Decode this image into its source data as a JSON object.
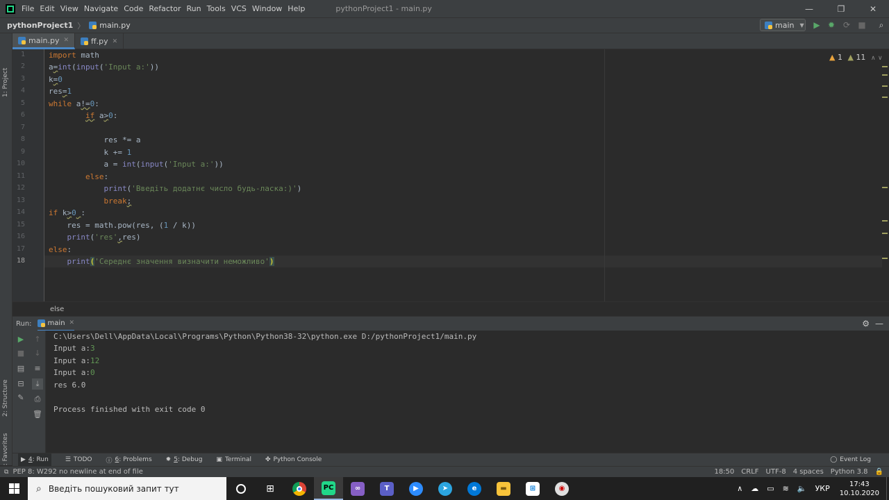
{
  "menubar": {
    "items": [
      "File",
      "Edit",
      "View",
      "Navigate",
      "Code",
      "Refactor",
      "Run",
      "Tools",
      "VCS",
      "Window",
      "Help"
    ],
    "window_title": "pythonProject1 - main.py",
    "minimize": "—",
    "maximize": "❐",
    "close": "✕"
  },
  "navbar": {
    "project": "pythonProject1",
    "file": "main.py",
    "run_config": "main",
    "run_config_arrow": "▼"
  },
  "left_strip": {
    "project_label": "1: Project",
    "structure_label": "2: Structure",
    "favorites_label": "2: Favorites"
  },
  "editor_tabs": [
    {
      "label": "main.py",
      "close": "✕",
      "active": true
    },
    {
      "label": "ff.py",
      "close": "✕",
      "active": false
    }
  ],
  "inspections": {
    "warnings": "1",
    "weak_warnings": "11"
  },
  "editor": {
    "line_numbers": [
      "1",
      "2",
      "3",
      "4",
      "5",
      "6",
      "7",
      "8",
      "9",
      "10",
      "11",
      "12",
      "13",
      "14",
      "15",
      "16",
      "17",
      "18"
    ],
    "current_line": 18
  },
  "breadcrumb_bottom": "else",
  "run_panel": {
    "label": "Run:",
    "tab": "main",
    "console_lines": [
      {
        "text": "C:\\Users\\Dell\\AppData\\Local\\Programs\\Python\\Python38-32\\python.exe D:/pythonProject1/main.py"
      },
      {
        "prompt": "Input a:",
        "input": "3"
      },
      {
        "prompt": "Input a:",
        "input": "12"
      },
      {
        "prompt": "Input a:",
        "input": "0"
      },
      {
        "text": "res 6.0"
      },
      {
        "text": ""
      },
      {
        "text": "Process finished with exit code 0"
      }
    ]
  },
  "tool_tabs": [
    {
      "num": "4",
      "label": ": Run",
      "icon": "run-icon"
    },
    {
      "num": "",
      "label": "TODO",
      "icon": "todo-icon"
    },
    {
      "num": "6",
      "label": ": Problems",
      "icon": "problems-icon"
    },
    {
      "num": "5",
      "label": ": Debug",
      "icon": "debug-icon"
    },
    {
      "num": "",
      "label": "Terminal",
      "icon": "terminal-icon"
    },
    {
      "num": "",
      "label": "Python Console",
      "icon": "python-console-icon"
    }
  ],
  "event_log": "Event Log",
  "statusbar": {
    "message": "PEP 8: W292 no newline at end of file",
    "position": "18:50",
    "line_sep": "CRLF",
    "encoding": "UTF-8",
    "indent": "4 spaces",
    "interpreter": "Python 3.8"
  },
  "taskbar": {
    "search_placeholder": "Введіть пошуковий запит тут",
    "language": "УКР",
    "time": "17:43",
    "date": "10.10.2020"
  },
  "colors": {
    "accent": "#4a88c7",
    "keyword": "#cc7832",
    "number": "#6897bb",
    "string": "#6a8759",
    "builtin": "#8888c6",
    "input_text": "#629755"
  }
}
